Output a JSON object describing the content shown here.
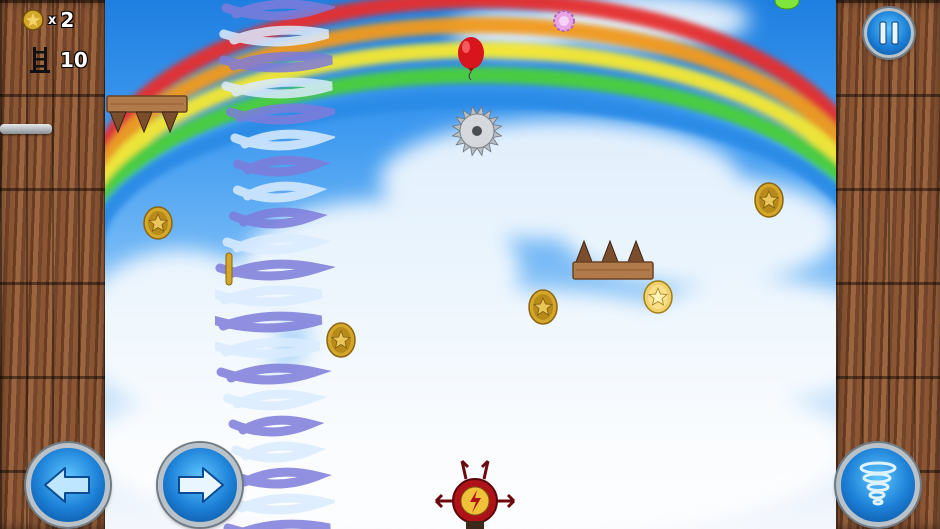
{
  "hud": {
    "coins_count": "2",
    "coins_x": "x",
    "height_count": "10"
  },
  "icons": {
    "coin": "coin-icon",
    "ladder": "ladder-icon",
    "pause": "pause-icon",
    "arrow_left": "left-arrow-icon",
    "arrow_right": "right-arrow-icon",
    "tornado": "tornado-icon"
  },
  "colors": {
    "sky_top": "#1f7fe0",
    "wall_wood": "#7b4a2c",
    "button_blue": "#1b7fd6",
    "coin_gold": "#d4a72a",
    "balloon_red": "#d8141c",
    "player_red": "#b0121a"
  }
}
